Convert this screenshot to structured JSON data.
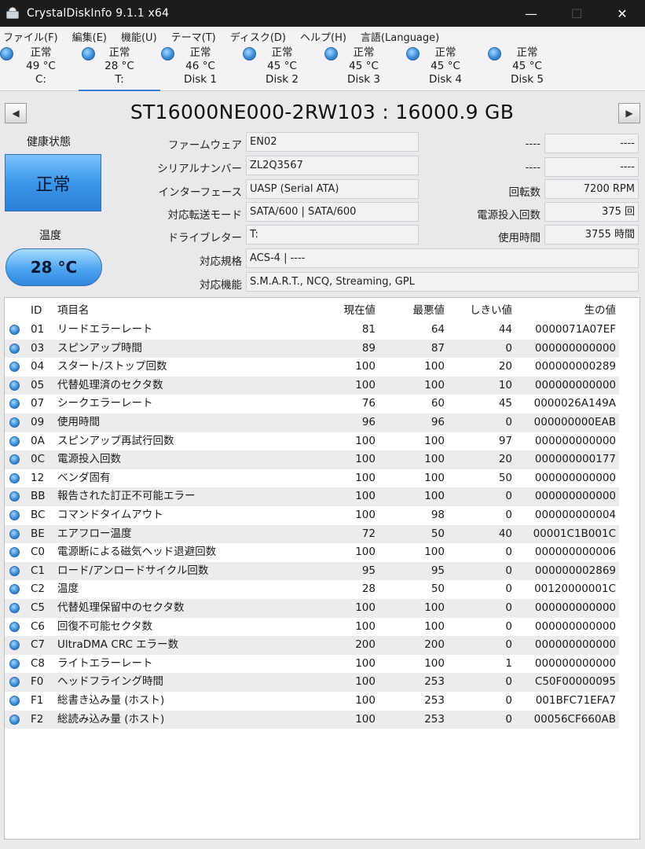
{
  "window": {
    "title": "CrystalDiskInfo 9.1.1 x64",
    "minimize": "—",
    "maximize": "☐",
    "close": "✕"
  },
  "menu": [
    "ファイル(F)",
    "編集(E)",
    "機能(U)",
    "テーマ(T)",
    "ディスク(D)",
    "ヘルプ(H)",
    "言語(Language)"
  ],
  "disks": [
    {
      "status": "正常",
      "temp": "49 °C",
      "name": "C:"
    },
    {
      "status": "正常",
      "temp": "28 °C",
      "name": "T:"
    },
    {
      "status": "正常",
      "temp": "46 °C",
      "name": "Disk 1"
    },
    {
      "status": "正常",
      "temp": "45 °C",
      "name": "Disk 2"
    },
    {
      "status": "正常",
      "temp": "45 °C",
      "name": "Disk 3"
    },
    {
      "status": "正常",
      "temp": "45 °C",
      "name": "Disk 4"
    },
    {
      "status": "正常",
      "temp": "45 °C",
      "name": "Disk 5"
    }
  ],
  "nav": {
    "prev": "◀",
    "next": "▶"
  },
  "model": "ST16000NE000-2RW103 : 16000.9 GB",
  "health": {
    "label": "健康状態",
    "value": "正常",
    "color": "#3a96ea"
  },
  "temperature": {
    "label": "温度",
    "value": "28 °C"
  },
  "info": {
    "firmware": {
      "label": "ファームウェア",
      "value": "EN02"
    },
    "serial": {
      "label": "シリアルナンバー",
      "value": "ZL2Q3567"
    },
    "interface": {
      "label": "インターフェース",
      "value": "UASP (Serial ATA)"
    },
    "transfer": {
      "label": "対応転送モード",
      "value": "SATA/600 | SATA/600"
    },
    "drive_letter": {
      "label": "ドライブレター",
      "value": "T:"
    },
    "standard": {
      "label": "対応規格",
      "value": "ACS-4 | ----"
    },
    "features": {
      "label": "対応機能",
      "value": "S.M.A.R.T., NCQ, Streaming, GPL"
    }
  },
  "right_info": {
    "r1": {
      "label": "----",
      "value": "----"
    },
    "r2": {
      "label": "----",
      "value": "----"
    },
    "rotation": {
      "label": "回転数",
      "value": "7200 RPM"
    },
    "power_count": {
      "label": "電源投入回数",
      "value": "375 回"
    },
    "power_hours": {
      "label": "使用時間",
      "value": "3755 時間"
    }
  },
  "smart_headers": {
    "id": "ID",
    "name": "項目名",
    "current": "現在値",
    "worst": "最悪値",
    "threshold": "しきい値",
    "raw": "生の値"
  },
  "smart_rows": [
    {
      "id": "01",
      "name": "リードエラーレート",
      "current": "81",
      "worst": "64",
      "threshold": "44",
      "raw": "0000071A07EF"
    },
    {
      "id": "03",
      "name": "スピンアップ時間",
      "current": "89",
      "worst": "87",
      "threshold": "0",
      "raw": "000000000000"
    },
    {
      "id": "04",
      "name": "スタート/ストップ回数",
      "current": "100",
      "worst": "100",
      "threshold": "20",
      "raw": "000000000289"
    },
    {
      "id": "05",
      "name": "代替処理済のセクタ数",
      "current": "100",
      "worst": "100",
      "threshold": "10",
      "raw": "000000000000"
    },
    {
      "id": "07",
      "name": "シークエラーレート",
      "current": "76",
      "worst": "60",
      "threshold": "45",
      "raw": "0000026A149A"
    },
    {
      "id": "09",
      "name": "使用時間",
      "current": "96",
      "worst": "96",
      "threshold": "0",
      "raw": "000000000EAB"
    },
    {
      "id": "0A",
      "name": "スピンアップ再試行回数",
      "current": "100",
      "worst": "100",
      "threshold": "97",
      "raw": "000000000000"
    },
    {
      "id": "0C",
      "name": "電源投入回数",
      "current": "100",
      "worst": "100",
      "threshold": "20",
      "raw": "000000000177"
    },
    {
      "id": "12",
      "name": "ベンダ固有",
      "current": "100",
      "worst": "100",
      "threshold": "50",
      "raw": "000000000000"
    },
    {
      "id": "BB",
      "name": "報告された訂正不可能エラー",
      "current": "100",
      "worst": "100",
      "threshold": "0",
      "raw": "000000000000"
    },
    {
      "id": "BC",
      "name": "コマンドタイムアウト",
      "current": "100",
      "worst": "98",
      "threshold": "0",
      "raw": "000000000004"
    },
    {
      "id": "BE",
      "name": "エアフロー温度",
      "current": "72",
      "worst": "50",
      "threshold": "40",
      "raw": "00001C1B001C"
    },
    {
      "id": "C0",
      "name": "電源断による磁気ヘッド退避回数",
      "current": "100",
      "worst": "100",
      "threshold": "0",
      "raw": "000000000006"
    },
    {
      "id": "C1",
      "name": "ロード/アンロードサイクル回数",
      "current": "95",
      "worst": "95",
      "threshold": "0",
      "raw": "000000002869"
    },
    {
      "id": "C2",
      "name": "温度",
      "current": "28",
      "worst": "50",
      "threshold": "0",
      "raw": "00120000001C"
    },
    {
      "id": "C5",
      "name": "代替処理保留中のセクタ数",
      "current": "100",
      "worst": "100",
      "threshold": "0",
      "raw": "000000000000"
    },
    {
      "id": "C6",
      "name": "回復不可能セクタ数",
      "current": "100",
      "worst": "100",
      "threshold": "0",
      "raw": "000000000000"
    },
    {
      "id": "C7",
      "name": "UltraDMA CRC エラー数",
      "current": "200",
      "worst": "200",
      "threshold": "0",
      "raw": "000000000000"
    },
    {
      "id": "C8",
      "name": "ライトエラーレート",
      "current": "100",
      "worst": "100",
      "threshold": "1",
      "raw": "000000000000"
    },
    {
      "id": "F0",
      "name": "ヘッドフライング時間",
      "current": "100",
      "worst": "253",
      "threshold": "0",
      "raw": "C50F00000095"
    },
    {
      "id": "F1",
      "name": "総書き込み量 (ホスト)",
      "current": "100",
      "worst": "253",
      "threshold": "0",
      "raw": "001BFC71EFA7"
    },
    {
      "id": "F2",
      "name": "総読み込み量 (ホスト)",
      "current": "100",
      "worst": "253",
      "threshold": "0",
      "raw": "00056CF660AB"
    }
  ]
}
